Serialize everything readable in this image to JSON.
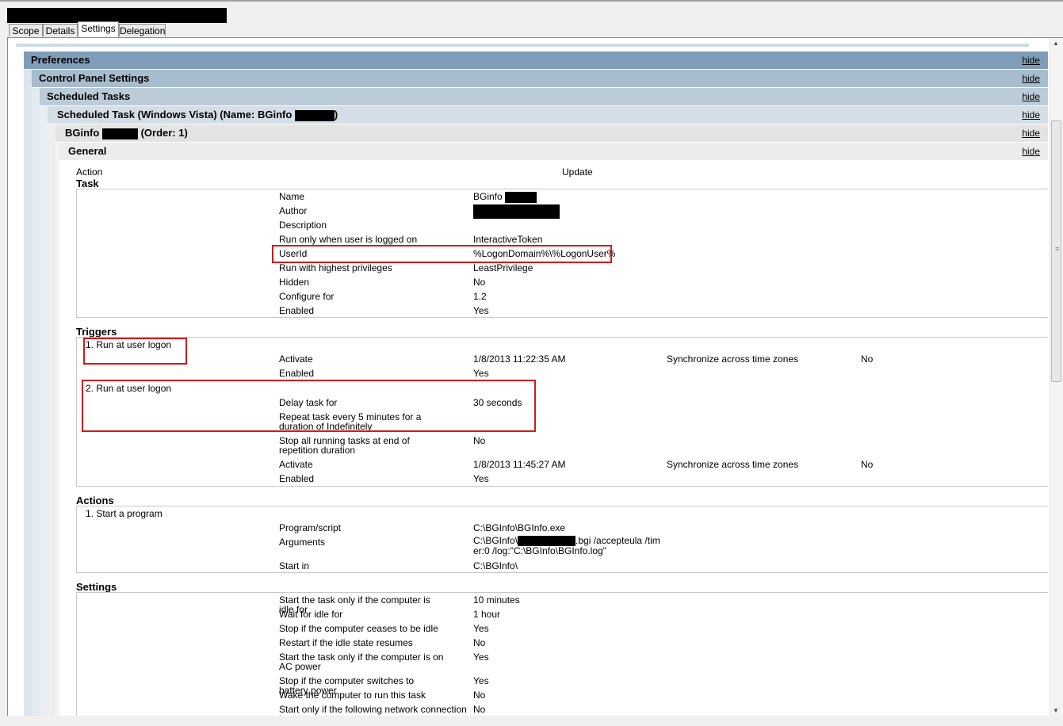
{
  "tabs": [
    "Scope",
    "Details",
    "Settings",
    "Delegation"
  ],
  "active_tab": "Settings",
  "hide_label": "hide",
  "headers": {
    "preferences": "Preferences",
    "control_panel": "Control Panel Settings",
    "scheduled_tasks": "Scheduled Tasks",
    "task_item_prefix": "Scheduled Task (Windows Vista) (Name: BGinfo",
    "task_item_suffix": ")",
    "bginfo_prefix": "BGinfo",
    "bginfo_suffix": "(Order: 1)",
    "general": "General"
  },
  "general": {
    "action_label": "Action",
    "action_value": "Update"
  },
  "task": {
    "title": "Task",
    "rows": [
      {
        "label": "Name",
        "value": "BGinfo"
      },
      {
        "label": "Author",
        "value": ""
      },
      {
        "label": "Description",
        "value": ""
      },
      {
        "label": "Run only when user is logged on",
        "value": "InteractiveToken"
      },
      {
        "label": "UserId",
        "value": "%LogonDomain%\\%LogonUser%"
      },
      {
        "label": "Run with highest privileges",
        "value": "LeastPrivilege"
      },
      {
        "label": "Hidden",
        "value": "No"
      },
      {
        "label": "Configure for",
        "value": "1.2"
      },
      {
        "label": "Enabled",
        "value": "Yes"
      }
    ]
  },
  "triggers": {
    "title": "Triggers",
    "t1": {
      "name": "1. Run at user logon",
      "activate_label": "Activate",
      "activate_value": "1/8/2013 11:22:35 AM",
      "sync_label": "Synchronize across time zones",
      "sync_value": "No",
      "enabled_label": "Enabled",
      "enabled_value": "Yes"
    },
    "t2": {
      "name": "2. Run at user logon",
      "delay_label": "Delay task for",
      "delay_value": "30 seconds",
      "repeat_label": "Repeat task every 5 minutes for a duration of Indefinitely",
      "stop_label": "Stop all running tasks at end of repetition duration",
      "stop_value": "No",
      "activate_label": "Activate",
      "activate_value": "1/8/2013 11:45:27 AM",
      "sync_label": "Synchronize across time zones",
      "sync_value": "No",
      "enabled_label": "Enabled",
      "enabled_value": "Yes"
    }
  },
  "actions": {
    "title": "Actions",
    "a1": {
      "name": "1. Start a program",
      "program_label": "Program/script",
      "program_value": "C:\\BGInfo\\BGInfo.exe",
      "args_label": "Arguments",
      "args_prefix": "C:\\BGInfo\\",
      "args_suffix": ".bgi /accepteula /tim",
      "args_line2": "er:0 /log:\"C:\\BGInfo\\BGInfo.log\"",
      "startin_label": "Start in",
      "startin_value": "C:\\BGInfo\\"
    }
  },
  "settings": {
    "title": "Settings",
    "rows": [
      {
        "label": "Start the task only if the computer is idle for",
        "value": "10 minutes"
      },
      {
        "label": "Wait for idle for",
        "value": "1 hour"
      },
      {
        "label": "Stop if the computer ceases to be idle",
        "value": "Yes"
      },
      {
        "label": "Restart if the idle state resumes",
        "value": "No"
      },
      {
        "label": "Start the task only if the computer is on AC power",
        "value": "Yes"
      },
      {
        "label": "Stop if the computer switches to battery power",
        "value": "Yes"
      },
      {
        "label": "Wake the computer to run this task",
        "value": "No"
      },
      {
        "label": "Start only if the following network connection is",
        "value": "No"
      }
    ]
  },
  "colors": {
    "header_preferences": "#7f9db9",
    "header_control_panel": "#a7bccd",
    "header_scheduled_tasks": "#bccbd8",
    "header_task_item": "#d5dee6",
    "header_bginfo": "#e3e3e3",
    "header_general": "#ececec",
    "highlight": "#d41919"
  }
}
